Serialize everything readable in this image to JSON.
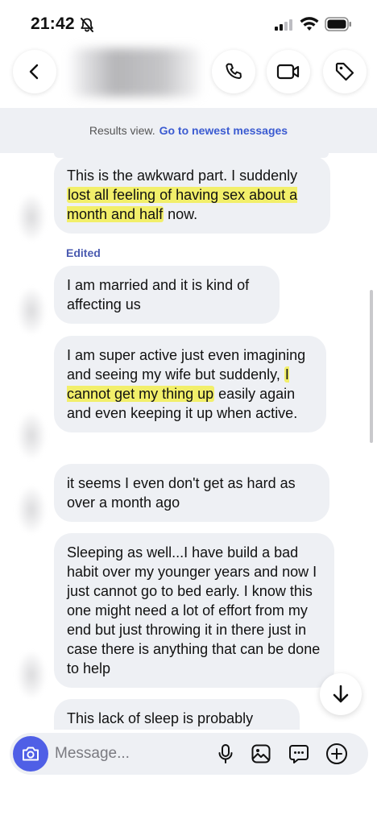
{
  "status_bar": {
    "time": "21:42"
  },
  "header": {
    "back_icon": "chevron-left-icon",
    "call_icon": "phone-icon",
    "video_icon": "video-camera-icon",
    "tag_icon": "tag-icon"
  },
  "results_banner": {
    "text": "Results view.",
    "link": "Go to newest messages"
  },
  "messages": [
    {
      "id": "m1",
      "parts": [
        {
          "text": "This is the awkward part. I suddenly ",
          "highlight": false
        },
        {
          "text": "lost all feeling of having sex about a month and half",
          "highlight": true
        },
        {
          "text": " now.",
          "highlight": false
        }
      ]
    },
    {
      "id": "m2",
      "edited_label": "Edited",
      "parts": [
        {
          "text": "I am married and it is kind of affecting us",
          "highlight": false
        }
      ]
    },
    {
      "id": "m3",
      "parts": [
        {
          "text": "I am super active just even imagining and seeing my wife but suddenly, ",
          "highlight": false
        },
        {
          "text": "I cannot get my thing up",
          "highlight": true
        },
        {
          "text": " easily again and even keeping it up when active.",
          "highlight": false
        }
      ]
    },
    {
      "id": "m4",
      "parts": [
        {
          "text": "it seems I even don't get as hard as over a month ago",
          "highlight": false
        }
      ]
    },
    {
      "id": "m5",
      "parts": [
        {
          "text": "Sleeping as well...I have build a bad habit over my younger years and now I just cannot go to bed early. I know this one might need a lot of effort from my end but just throwing it in there just in case there is anything that can be done to help",
          "highlight": false
        }
      ]
    },
    {
      "id": "m6",
      "parts": [
        {
          "text": "This lack of sleep is probably",
          "highlight": false
        }
      ]
    }
  ],
  "composer": {
    "placeholder": "Message...",
    "camera_icon": "camera-icon",
    "mic_icon": "microphone-icon",
    "gallery_icon": "image-icon",
    "sticker_icon": "sticker-chat-icon",
    "plus_icon": "plus-circle-icon"
  },
  "jump_button_icon": "arrow-down-icon",
  "colors": {
    "bubble": "#eef0f4",
    "highlight": "#f2ef6a",
    "accent": "#4f5fe6",
    "link": "#3b5bd1"
  }
}
